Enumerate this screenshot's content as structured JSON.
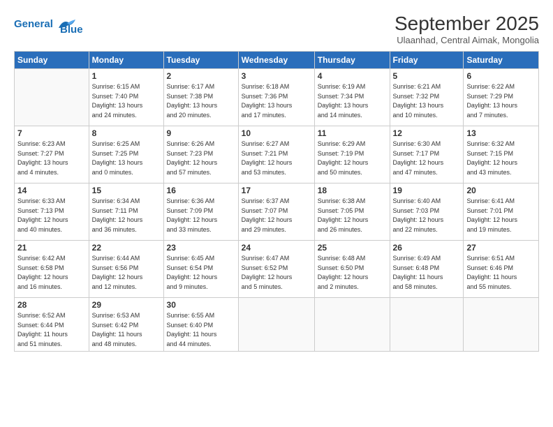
{
  "header": {
    "logo_line1": "General",
    "logo_line2": "Blue",
    "month_title": "September 2025",
    "location": "Ulaanhad, Central Aimak, Mongolia"
  },
  "days_of_week": [
    "Sunday",
    "Monday",
    "Tuesday",
    "Wednesday",
    "Thursday",
    "Friday",
    "Saturday"
  ],
  "weeks": [
    [
      {
        "day": "",
        "info": ""
      },
      {
        "day": "1",
        "info": "Sunrise: 6:15 AM\nSunset: 7:40 PM\nDaylight: 13 hours\nand 24 minutes."
      },
      {
        "day": "2",
        "info": "Sunrise: 6:17 AM\nSunset: 7:38 PM\nDaylight: 13 hours\nand 20 minutes."
      },
      {
        "day": "3",
        "info": "Sunrise: 6:18 AM\nSunset: 7:36 PM\nDaylight: 13 hours\nand 17 minutes."
      },
      {
        "day": "4",
        "info": "Sunrise: 6:19 AM\nSunset: 7:34 PM\nDaylight: 13 hours\nand 14 minutes."
      },
      {
        "day": "5",
        "info": "Sunrise: 6:21 AM\nSunset: 7:32 PM\nDaylight: 13 hours\nand 10 minutes."
      },
      {
        "day": "6",
        "info": "Sunrise: 6:22 AM\nSunset: 7:29 PM\nDaylight: 13 hours\nand 7 minutes."
      }
    ],
    [
      {
        "day": "7",
        "info": "Sunrise: 6:23 AM\nSunset: 7:27 PM\nDaylight: 13 hours\nand 4 minutes."
      },
      {
        "day": "8",
        "info": "Sunrise: 6:25 AM\nSunset: 7:25 PM\nDaylight: 13 hours\nand 0 minutes."
      },
      {
        "day": "9",
        "info": "Sunrise: 6:26 AM\nSunset: 7:23 PM\nDaylight: 12 hours\nand 57 minutes."
      },
      {
        "day": "10",
        "info": "Sunrise: 6:27 AM\nSunset: 7:21 PM\nDaylight: 12 hours\nand 53 minutes."
      },
      {
        "day": "11",
        "info": "Sunrise: 6:29 AM\nSunset: 7:19 PM\nDaylight: 12 hours\nand 50 minutes."
      },
      {
        "day": "12",
        "info": "Sunrise: 6:30 AM\nSunset: 7:17 PM\nDaylight: 12 hours\nand 47 minutes."
      },
      {
        "day": "13",
        "info": "Sunrise: 6:32 AM\nSunset: 7:15 PM\nDaylight: 12 hours\nand 43 minutes."
      }
    ],
    [
      {
        "day": "14",
        "info": "Sunrise: 6:33 AM\nSunset: 7:13 PM\nDaylight: 12 hours\nand 40 minutes."
      },
      {
        "day": "15",
        "info": "Sunrise: 6:34 AM\nSunset: 7:11 PM\nDaylight: 12 hours\nand 36 minutes."
      },
      {
        "day": "16",
        "info": "Sunrise: 6:36 AM\nSunset: 7:09 PM\nDaylight: 12 hours\nand 33 minutes."
      },
      {
        "day": "17",
        "info": "Sunrise: 6:37 AM\nSunset: 7:07 PM\nDaylight: 12 hours\nand 29 minutes."
      },
      {
        "day": "18",
        "info": "Sunrise: 6:38 AM\nSunset: 7:05 PM\nDaylight: 12 hours\nand 26 minutes."
      },
      {
        "day": "19",
        "info": "Sunrise: 6:40 AM\nSunset: 7:03 PM\nDaylight: 12 hours\nand 22 minutes."
      },
      {
        "day": "20",
        "info": "Sunrise: 6:41 AM\nSunset: 7:01 PM\nDaylight: 12 hours\nand 19 minutes."
      }
    ],
    [
      {
        "day": "21",
        "info": "Sunrise: 6:42 AM\nSunset: 6:58 PM\nDaylight: 12 hours\nand 16 minutes."
      },
      {
        "day": "22",
        "info": "Sunrise: 6:44 AM\nSunset: 6:56 PM\nDaylight: 12 hours\nand 12 minutes."
      },
      {
        "day": "23",
        "info": "Sunrise: 6:45 AM\nSunset: 6:54 PM\nDaylight: 12 hours\nand 9 minutes."
      },
      {
        "day": "24",
        "info": "Sunrise: 6:47 AM\nSunset: 6:52 PM\nDaylight: 12 hours\nand 5 minutes."
      },
      {
        "day": "25",
        "info": "Sunrise: 6:48 AM\nSunset: 6:50 PM\nDaylight: 12 hours\nand 2 minutes."
      },
      {
        "day": "26",
        "info": "Sunrise: 6:49 AM\nSunset: 6:48 PM\nDaylight: 11 hours\nand 58 minutes."
      },
      {
        "day": "27",
        "info": "Sunrise: 6:51 AM\nSunset: 6:46 PM\nDaylight: 11 hours\nand 55 minutes."
      }
    ],
    [
      {
        "day": "28",
        "info": "Sunrise: 6:52 AM\nSunset: 6:44 PM\nDaylight: 11 hours\nand 51 minutes."
      },
      {
        "day": "29",
        "info": "Sunrise: 6:53 AM\nSunset: 6:42 PM\nDaylight: 11 hours\nand 48 minutes."
      },
      {
        "day": "30",
        "info": "Sunrise: 6:55 AM\nSunset: 6:40 PM\nDaylight: 11 hours\nand 44 minutes."
      },
      {
        "day": "",
        "info": ""
      },
      {
        "day": "",
        "info": ""
      },
      {
        "day": "",
        "info": ""
      },
      {
        "day": "",
        "info": ""
      }
    ]
  ]
}
